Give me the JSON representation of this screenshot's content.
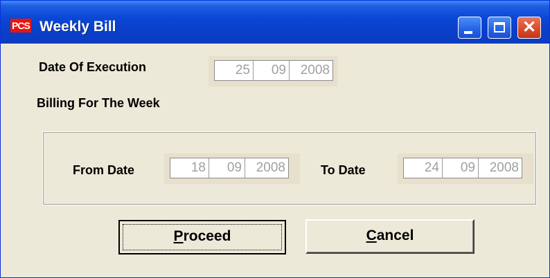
{
  "window": {
    "title": "Weekly Bill",
    "app_icon_text": "PCS",
    "controls": {
      "minimize": "minimize-icon",
      "maximize": "maximize-icon",
      "close": "close-icon"
    }
  },
  "form": {
    "date_of_execution_label": "Date Of Execution",
    "date_of_execution": {
      "day": "25",
      "month": "09",
      "year": "2008"
    },
    "billing_label": "Billing For The Week",
    "from_date_label": "From Date",
    "from_date": {
      "day": "18",
      "month": "09",
      "year": "2008"
    },
    "to_date_label": "To Date",
    "to_date": {
      "day": "24",
      "month": "09",
      "year": "2008"
    }
  },
  "buttons": {
    "proceed_first": "P",
    "proceed_rest": "roceed",
    "cancel_first": "C",
    "cancel_rest": "ancel"
  },
  "colors": {
    "titlebar": "#0a47d6",
    "face": "#ece9d8",
    "close": "#d84a28"
  }
}
